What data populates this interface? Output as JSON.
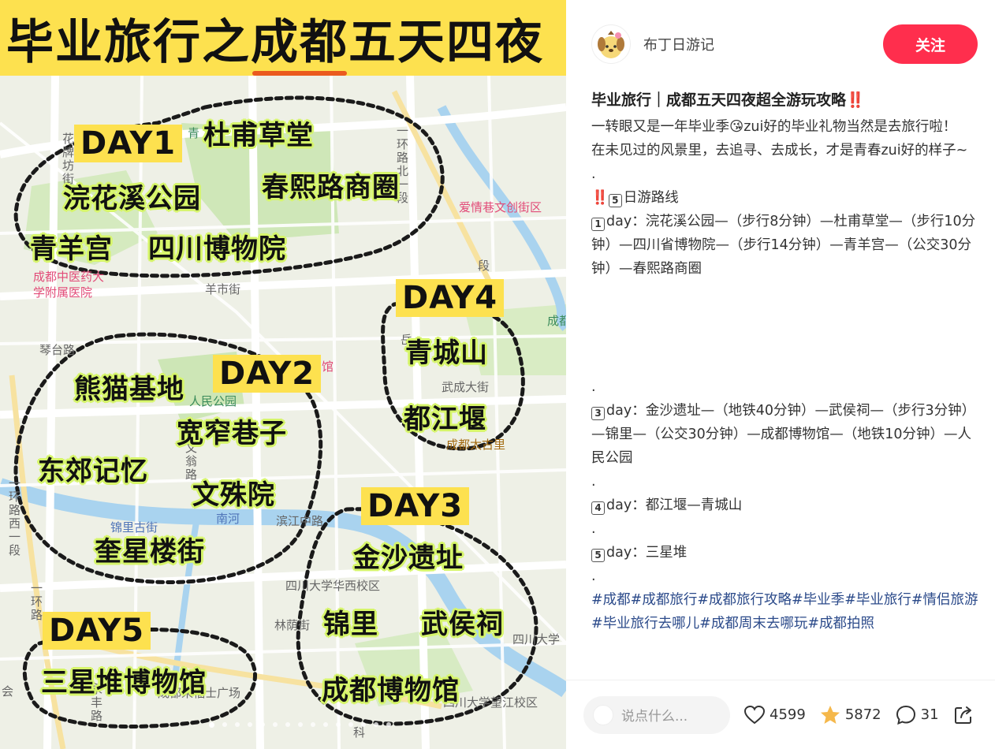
{
  "image": {
    "title_pre": "毕业旅行之",
    "title_highlight": "成都",
    "title_post": "五天四夜",
    "map_labels": {
      "du_fu_small": "青",
      "aiqing_lane": "爱情巷文创街区",
      "tcm_hospital_1": "成都中医药大",
      "tcm_hospital_2": "学附属医院",
      "yangshi_street": "羊市街",
      "qinjia_road": "琴台路",
      "renmin_park": "人民公园",
      "guan": "馆",
      "jinli_street": "锦里古街",
      "nanhe": "南河",
      "binjiang_road": "滨江中路",
      "sichuan_huaxi": "四川大学华西校区",
      "linyin_street": "林荫街",
      "sichuan_univ": "四川大学",
      "sichuan_wangjiang": "四川大学望江校区",
      "taikoo_li": "成都太古里",
      "wucheng_street": "武成大街",
      "chengdu_right": "成都",
      "laifu_plaza": "成都来福士广场",
      "yue": "岳",
      "ke": "科",
      "hui": "会",
      "wenweng": "文翁路",
      "huaxi_road": "花牌坊街",
      "yihuan_west": "一环路西一段",
      "yihuan": "一环路",
      "yihuan_north": "一环路北一段",
      "road_seg": "段",
      "yong_feng": "永丰路"
    },
    "days": [
      {
        "tag": "DAY1",
        "places": [
          "杜甫草堂",
          "浣花溪公园",
          "春熙路商圈",
          "青羊宫",
          "四川博物院"
        ]
      },
      {
        "tag": "DAY2",
        "places": [
          "熊猫基地",
          "宽窄巷子",
          "东郊记忆",
          "文殊院",
          "奎星楼街"
        ]
      },
      {
        "tag": "DAY3",
        "places": [
          "金沙遗址",
          "锦里",
          "武侯祠",
          "成都博物馆"
        ]
      },
      {
        "tag": "DAY4",
        "places": [
          "青城山",
          "都江堰"
        ]
      },
      {
        "tag": "DAY5",
        "places": [
          "三星堆博物馆"
        ]
      }
    ]
  },
  "author": {
    "name": "布丁日游记",
    "follow_label": "关注"
  },
  "note": {
    "title": "毕业旅行｜成都五天四夜超全游玩攻略‼️",
    "intro_1a": "一转眼又是一年毕业季",
    "intro_1_emoji": "😘",
    "intro_1b": "zui好的毕业礼物当然是去旅行啦！",
    "intro_2": "在未见过的风景里，去追寻、去成长，才是青春zui好的样子~",
    "dot": ".",
    "route_title": "‼️",
    "route_key": "5",
    "route_title_text": "日游路线",
    "day1_key": "1",
    "day1": "day：浣花溪公园—（步行8分钟）—杜甫草堂—（步行10分钟）—四川省博物院—（步行14分钟）—青羊宫—（公交30分钟）—春熙路商圈",
    "day3_key": "3",
    "day3": "day：金沙遗址—（地铁40分钟）—武侯祠—（步行3分钟）—锦里—（公交30分钟）—成都博物馆—（地铁10分钟）—人民公园",
    "day4_key": "4",
    "day4": "day：都江堰—青城山",
    "day5_key": "5",
    "day5": "day：三星堆",
    "tags": [
      "#成都",
      "#成都旅行",
      "#成都旅行攻略",
      "#毕业季",
      "#毕业旅行",
      "#情侣旅游",
      "#毕业旅行去哪儿",
      "#成都周末去哪玩",
      "#成都拍照"
    ]
  },
  "bottom": {
    "comment_placeholder": "说点什么...",
    "likes": "4599",
    "collects": "5872",
    "comments": "31"
  },
  "colors": {
    "accent": "#ff2e4d",
    "title_bg": "#fde14f",
    "place_glow": "#d6f56a",
    "tag_text": "#2b4a8a"
  }
}
